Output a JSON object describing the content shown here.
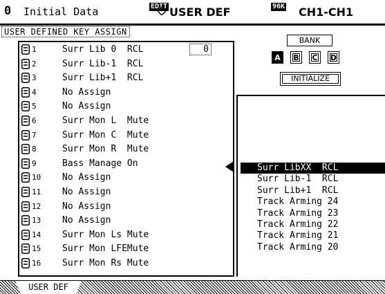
{
  "header": {
    "scene_number": "0",
    "scene_title": "Initial Data",
    "edit_badge": "EDIT",
    "page_title": "USER DEF",
    "fs_badge": "96K",
    "channel": "CH1-CH1"
  },
  "section_label": "USER DEFINED KEY ASSIGN",
  "assignments": [
    {
      "num": "1",
      "label": "Surr Lib 0  RCL"
    },
    {
      "num": "2",
      "label": "Surr Lib-1  RCL"
    },
    {
      "num": "3",
      "label": "Surr Lib+1  RCL"
    },
    {
      "num": "4",
      "label": "No Assign"
    },
    {
      "num": "5",
      "label": "No Assign"
    },
    {
      "num": "6",
      "label": "Surr Mon L  Mute"
    },
    {
      "num": "7",
      "label": "Surr Mon C  Mute"
    },
    {
      "num": "8",
      "label": "Surr Mon R  Mute"
    },
    {
      "num": "9",
      "label": "Bass Manage On"
    },
    {
      "num": "10",
      "label": "No Assign"
    },
    {
      "num": "11",
      "label": "No Assign"
    },
    {
      "num": "12",
      "label": "No Assign"
    },
    {
      "num": "13",
      "label": "No Assign"
    },
    {
      "num": "14",
      "label": "Surr Mon Ls Mute"
    },
    {
      "num": "15",
      "label": "Surr Mon LFEMute"
    },
    {
      "num": "16",
      "label": "Surr Mon Rs Mute"
    }
  ],
  "recall_value": "0",
  "bank": {
    "label": "BANK",
    "buttons": [
      "A",
      "B",
      "C",
      "D"
    ],
    "selected": "A",
    "initialize_label": "INITIALIZE"
  },
  "functions": [
    "Surr LibXX  RCL",
    "Surr Lib-1  RCL",
    "Surr Lib+1  RCL",
    "Track Arming 24",
    "Track Arming 23",
    "Track Arming 22",
    "Track Arming 21",
    "Track Arming 20"
  ],
  "selected_function_index": 0,
  "tabs": [
    {
      "label": "USER DEF"
    }
  ]
}
